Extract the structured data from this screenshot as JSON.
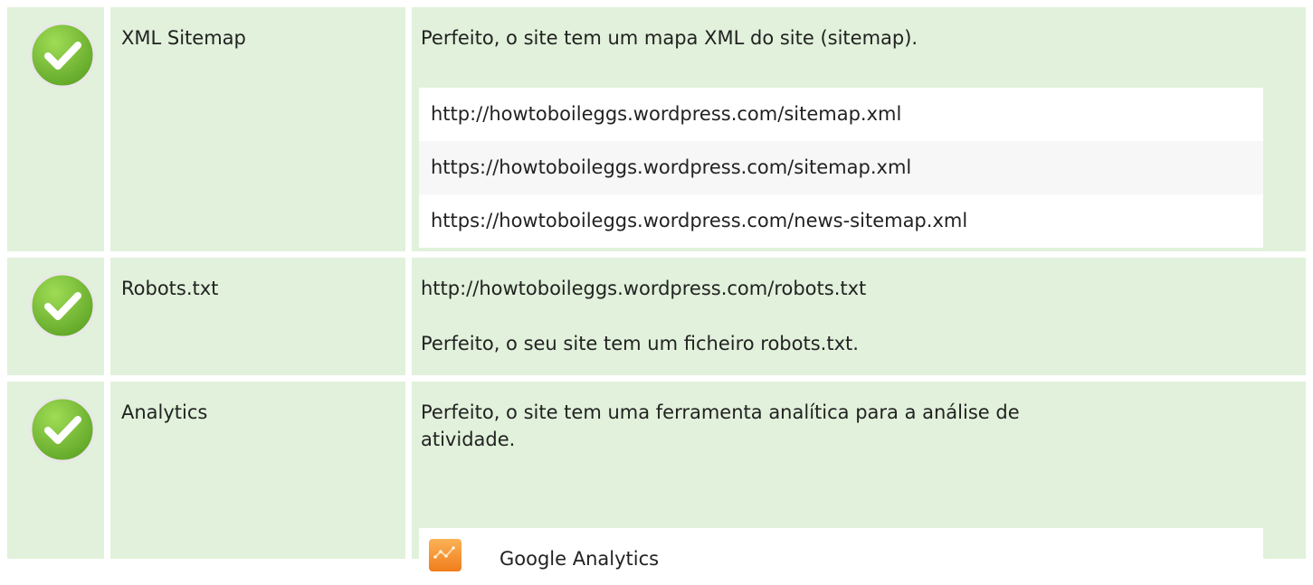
{
  "colors": {
    "row_bg": "#e1f1db",
    "check_green": "#7cc23c",
    "ga_orange": "#f58b2a"
  },
  "rows": [
    {
      "name": "XML Sitemap",
      "icon": "check-circle-icon",
      "description": "Perfeito, o site tem um mapa XML do site (sitemap).",
      "urls": [
        "http://howtoboileggs.wordpress.com/sitemap.xml",
        "https://howtoboileggs.wordpress.com/sitemap.xml",
        "https://howtoboileggs.wordpress.com/news-sitemap.xml"
      ]
    },
    {
      "name": "Robots.txt",
      "icon": "check-circle-icon",
      "url": "http://howtoboileggs.wordpress.com/robots.txt",
      "description": "Perfeito, o seu site tem um ficheiro robots.txt."
    },
    {
      "name": "Analytics",
      "icon": "check-circle-icon",
      "description": "Perfeito, o site tem uma ferramenta analítica para a análise de atividade.",
      "tool": {
        "icon": "google-analytics-icon",
        "name": "Google Analytics"
      }
    }
  ]
}
